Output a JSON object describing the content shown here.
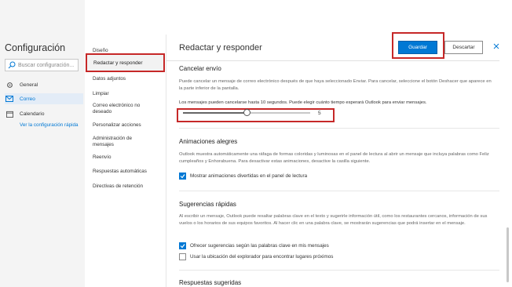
{
  "app": {
    "title": "Configuración",
    "search_placeholder": "Buscar configuración..."
  },
  "sidebar": {
    "items": [
      {
        "label": "General",
        "icon": "gear-icon"
      },
      {
        "label": "Correo",
        "icon": "mail-icon"
      },
      {
        "label": "Calendario",
        "icon": "calendar-icon"
      }
    ],
    "quick_link": "Ver la configuración rápida"
  },
  "subnav": {
    "items": [
      "Diseño",
      "Redactar y responder",
      "Datos adjuntos",
      "Limpiar",
      "Correo electrónico no deseado",
      "Personalizar acciones",
      "Administración de mensajes",
      "Reenvío",
      "Respuestas automáticas",
      "Directivas de retención"
    ],
    "selected": "Redactar y responder"
  },
  "header": {
    "title": "Redactar y responder",
    "save_label": "Guardar",
    "discard_label": "Descartar",
    "close_icon": "close-icon"
  },
  "undo_send": {
    "title": "Cancelar envío",
    "description": "Puede cancelar un mensaje de correo electrónico después de que haya seleccionado Enviar. Para cancelar, seleccione el botón Deshacer que aparece en la parte inferior de la pantalla.",
    "limit_text": "Los mensajes pueden cancelarse hasta 10 segundos. Puede elegir cuánto tiempo esperará Outlook para enviar mensajes.",
    "slider_value": "5",
    "slider_fraction": 0.5
  },
  "animations": {
    "title": "Animaciones alegres",
    "description": "Outlook muestra automáticamente una ráfaga de formas coloridas y luminosas en el panel de lectura al abrir un mensaje que incluya palabras como Feliz cumpleaños y Enhorabuena. Para desactivar estas animaciones, desactive la casilla siguiente.",
    "checkbox_label": "Mostrar animaciones divertidas en el panel de lectura",
    "checked": true
  },
  "suggestions": {
    "title": "Sugerencias rápidas",
    "description": "Al escribir un mensaje, Outlook puede resaltar palabras clave en el texto y sugerirle información útil, como los restaurantes cercanos, información de sus vuelos o los horarios de sus equipos favoritos. Al hacer clic en una palabra clave, se mostrarán sugerencias que podrá insertar en el mensaje.",
    "option1": "Ofrecer sugerencias según las palabras clave en mis mensajes",
    "option1_checked": true,
    "option2": "Usar la ubicación del explorador para encontrar lugares próximos",
    "option2_checked": false
  },
  "suggested_replies": {
    "title": "Respuestas sugeridas"
  },
  "colors": {
    "accent": "#0078d4",
    "highlight": "#c62828"
  }
}
